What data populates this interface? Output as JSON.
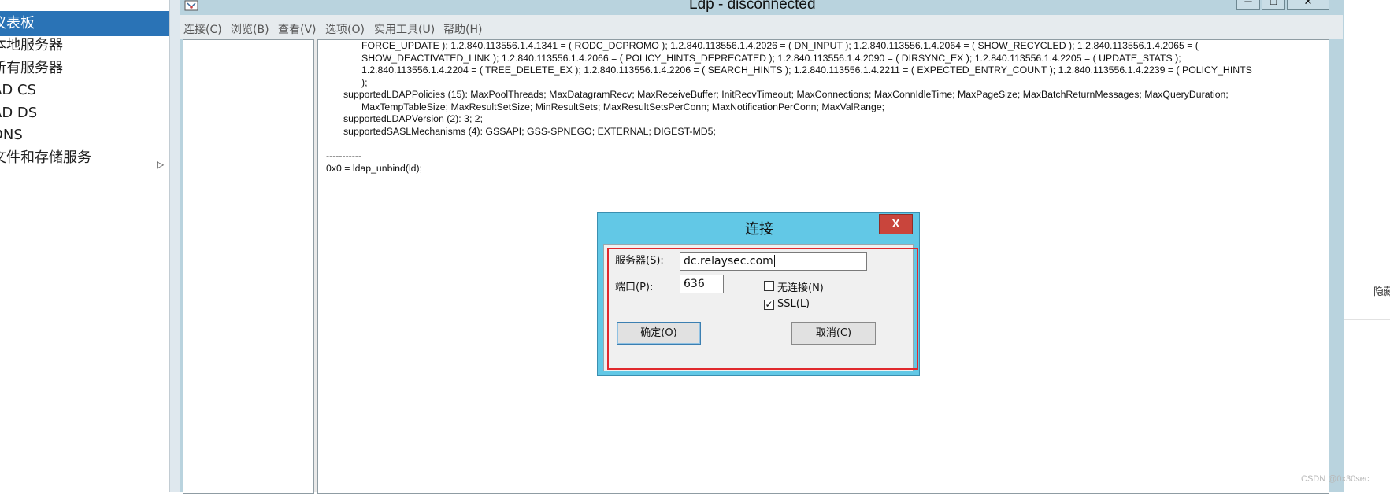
{
  "server_manager": {
    "nav": [
      {
        "label": "仪表板",
        "active": true
      },
      {
        "label": "本地服务器",
        "active": false
      },
      {
        "label": "所有服务器",
        "active": false
      },
      {
        "label": "AD CS",
        "active": false
      },
      {
        "label": "AD DS",
        "active": false
      },
      {
        "label": "DNS",
        "active": false
      },
      {
        "label": "文件和存储服务",
        "active": false,
        "has_submenu": true
      }
    ],
    "nav_arrow": "▷",
    "right_label": "隐藏"
  },
  "ldp": {
    "title": "Ldp - disconnected",
    "caption_buttons": {
      "minimize": "─",
      "maximize": "□",
      "close": "✕"
    },
    "menu": [
      "连接(C)",
      "浏览(B)",
      "查看(V)",
      "选项(O)",
      "实用工具(U)",
      "帮助(H)"
    ],
    "output_lines": [
      "FORCE_UPDATE ); 1.2.840.113556.1.4.1341 = ( RODC_DCPROMO ); 1.2.840.113556.1.4.2026 = ( DN_INPUT ); 1.2.840.113556.1.4.2064 = ( SHOW_RECYCLED ); 1.2.840.113556.1.4.2065 = (",
      "SHOW_DEACTIVATED_LINK ); 1.2.840.113556.1.4.2066 = ( POLICY_HINTS_DEPRECATED ); 1.2.840.113556.1.4.2090 = ( DIRSYNC_EX ); 1.2.840.113556.1.4.2205 = ( UPDATE_STATS );",
      "1.2.840.113556.1.4.2204 = ( TREE_DELETE_EX ); 1.2.840.113556.1.4.2206 = ( SEARCH_HINTS ); 1.2.840.113556.1.4.2211 = ( EXPECTED_ENTRY_COUNT ); 1.2.840.113556.1.4.2239 = ( POLICY_HINTS",
      ");",
      "supportedLDAPPolicies (15): MaxPoolThreads; MaxDatagramRecv; MaxReceiveBuffer; InitRecvTimeout; MaxConnections; MaxConnIdleTime; MaxPageSize; MaxBatchReturnMessages; MaxQueryDuration;",
      "MaxTempTableSize; MaxResultSetSize; MinResultSets; MaxResultSetsPerConn; MaxNotificationPerConn; MaxValRange;",
      "supportedLDAPVersion (2): 3; 2;",
      "supportedSASLMechanisms (4): GSSAPI; GSS-SPNEGO; EXTERNAL; DIGEST-MD5;",
      "-----------",
      "0x0 = ldap_unbind(ld);"
    ],
    "scroll_up": "▲",
    "scroll_grip": "≡"
  },
  "connect_dialog": {
    "title": "连接",
    "close": "X",
    "server_label": "服务器(S):",
    "server_value": "dc.relaysec.com",
    "port_label": "端口(P):",
    "port_value": "636",
    "connectionless_label": "无连接(N)",
    "connectionless_checked": false,
    "ssl_label": "SSL(L)",
    "ssl_checked": true,
    "check_mark": "✓",
    "ok_label": "确定(O)",
    "cancel_label": "取消(C)"
  },
  "watermark": "CSDN @0x30sec"
}
